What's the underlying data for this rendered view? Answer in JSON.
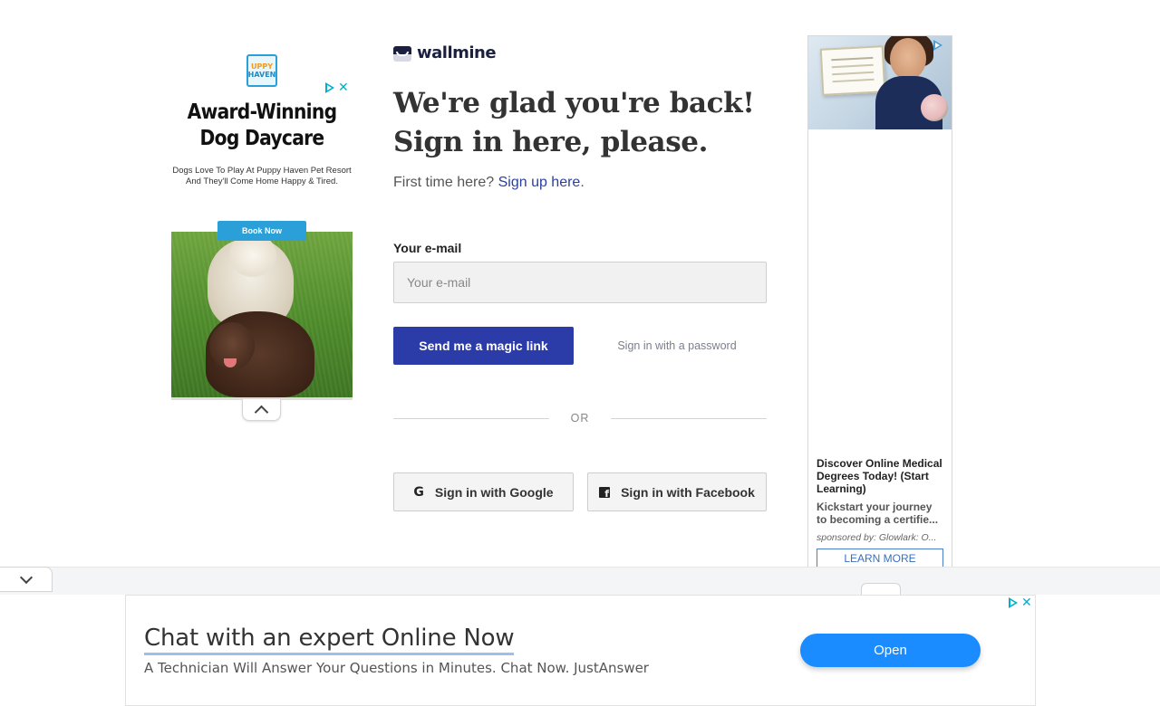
{
  "brand": {
    "name": "wallmine"
  },
  "login": {
    "headline_line1": "We're glad you're back!",
    "headline_line2": "Sign in here, please.",
    "first_time_text": "First time here?",
    "signup_link": "Sign up here",
    "signup_suffix": ".",
    "email_label": "Your e-mail",
    "email_placeholder": "Your e-mail",
    "email_value": "",
    "magic_link_button": "Send me a magic link",
    "password_link": "Sign in with a password",
    "or_divider": "OR",
    "google_button": "Sign in with Google",
    "facebook_button": "Sign in with Facebook"
  },
  "left_ad": {
    "logo_lines": [
      "UPPY",
      "HAVEN"
    ],
    "title_line1": "Award-Winning",
    "title_line2": "Dog Daycare",
    "body_line1": "Dogs Love To Play At Puppy Haven Pet Resort",
    "body_line2": "And They'll Come Home Happy & Tired.",
    "cta": "Book Now"
  },
  "right_ad": {
    "title": "Discover Online Medical Degrees Today! (Start Learning)",
    "desc_line1": "Kickstart your journey",
    "desc_line2": "to becoming a certifie...",
    "sponsor": "sponsored by: Glowlark: O...",
    "cta": "LEARN MORE"
  },
  "bottom_ad": {
    "title": "Chat with an expert Online Now",
    "description": "A Technician Will Answer Your Questions in Minutes. Chat Now. JustAnswer",
    "cta": "Open"
  },
  "icons": {
    "ad_choices": "ad-choices-icon",
    "ad_close": "close-icon",
    "collapse": "chevron-up-icon",
    "expand": "chevron-down-icon",
    "google": "google-icon",
    "facebook": "facebook-icon"
  },
  "colors": {
    "primary_button": "#2b3ca8",
    "link": "#2b3fa0",
    "brand_dark": "#1c2040",
    "open_button": "#1a8cff"
  }
}
